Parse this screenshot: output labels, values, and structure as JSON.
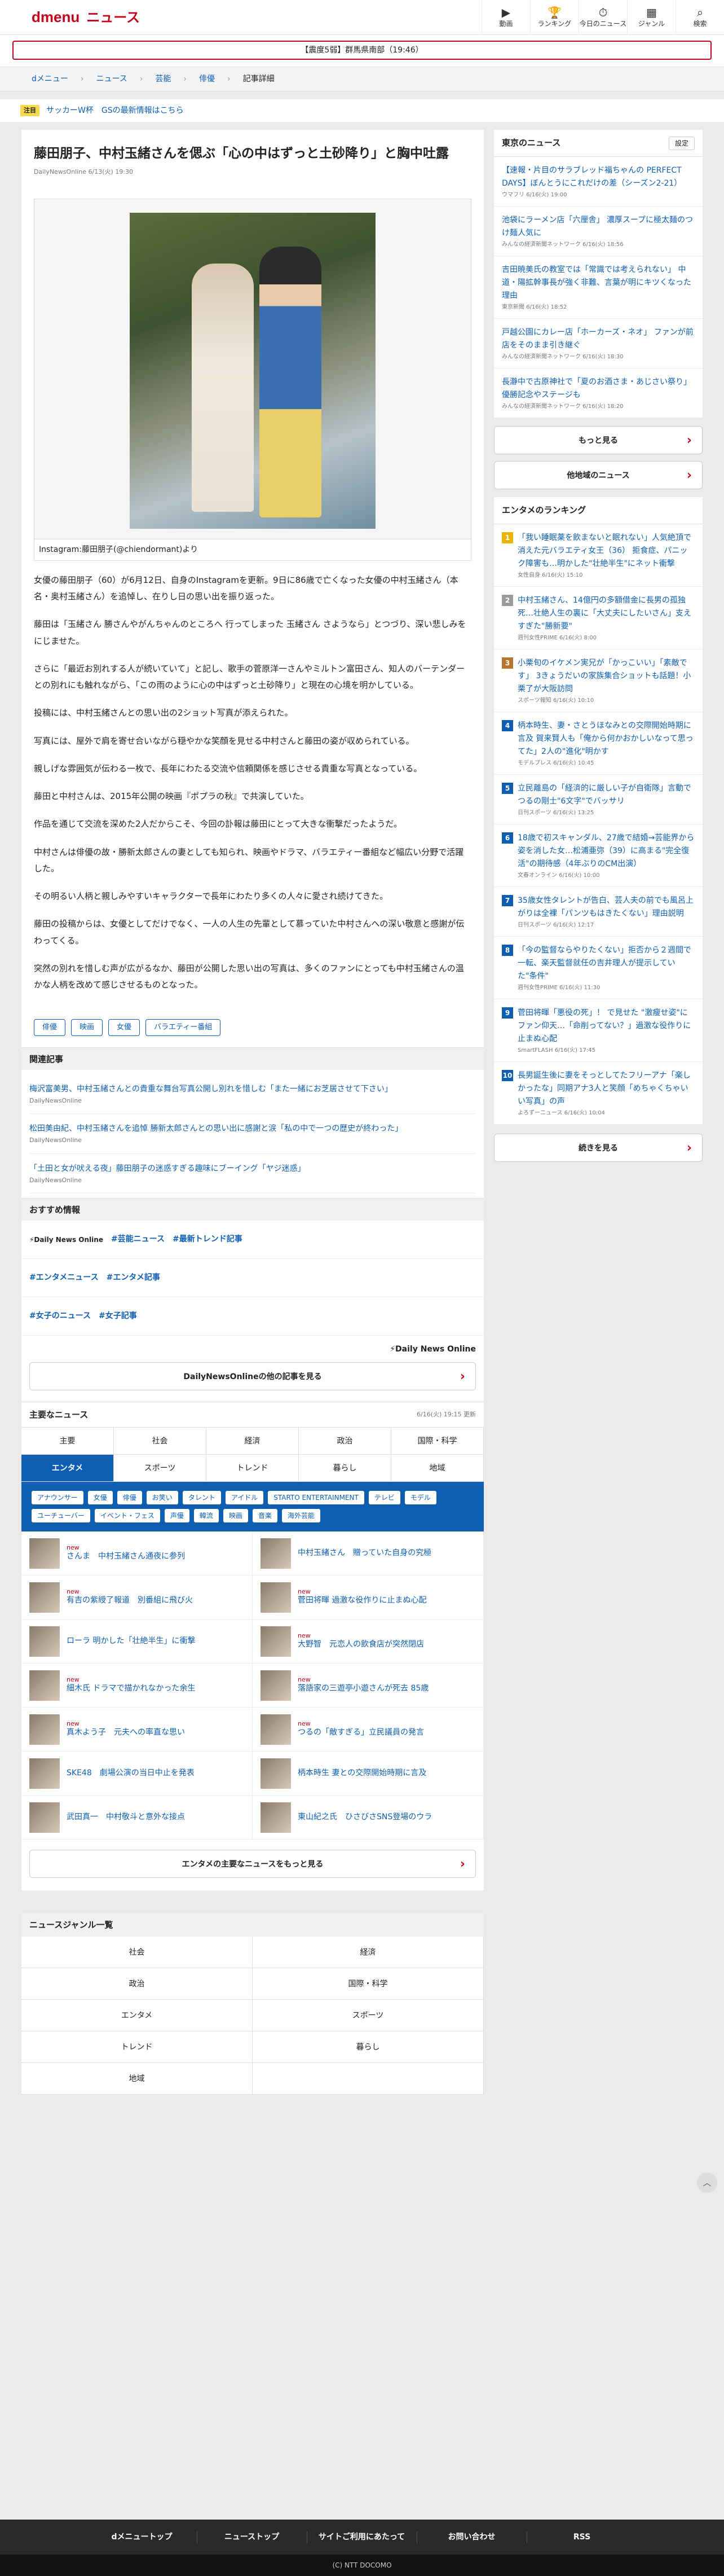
{
  "header": {
    "logo": "dmenu",
    "section": "ニュース",
    "nav": [
      {
        "icon": "video-icon",
        "glyph": "▶",
        "label": "動画"
      },
      {
        "icon": "trophy-icon",
        "glyph": "🏆",
        "label": "ランキング"
      },
      {
        "icon": "clock-icon",
        "glyph": "⏱",
        "label": "今日のニュース"
      },
      {
        "icon": "grid-icon",
        "glyph": "▦",
        "label": "ジャンル"
      },
      {
        "icon": "search-icon",
        "glyph": "⌕",
        "label": "検索"
      }
    ]
  },
  "alert": "【震度5弱】群馬県南部（19:46）",
  "breadcrumb": [
    "dメニュー",
    "ニュース",
    "芸能",
    "俳優",
    "記事詳細"
  ],
  "notice": {
    "tag": "注目",
    "text": "サッカーW杯　GSの最新情報はこちら"
  },
  "article": {
    "title": "藤田朋子、中村玉緒さんを偲ぶ「心の中はずっと土砂降り」と胸中吐露",
    "meta": "DailyNewsOnline 6/13(火) 19:30",
    "caption": "Instagram:藤田朋子(@chiendormant)より",
    "paragraphs": [
      "女優の藤田朋子（60）が6月12日、自身のInstagramを更新。9日に86歳で亡くなった女優の中村玉緒さん（本名・奥村玉緒さん）を追悼し、在りし日の思い出を振り返った。",
      "藤田は「玉緒さん 勝さんやがんちゃんのところへ 行ってしまった 玉緒さん さようなら」とつづり、深い悲しみをにじませた。",
      "さらに「最近お別れする人が続いていて」と記し、歌手の菅原洋一さんやミルトン富田さん、知人のバーテンダーとの別れにも触れながら、「この雨のように心の中はずっと土砂降り」と現在の心境を明かしている。",
      "投稿には、中村玉緒さんとの思い出の2ショット写真が添えられた。",
      "写真には、屋外で肩を寄せ合いながら穏やかな笑顔を見せる中村さんと藤田の姿が収められている。",
      "親しげな雰囲気が伝わる一枚で、長年にわたる交流や信頼関係を感じさせる貴重な写真となっている。",
      "藤田と中村さんは、2015年公開の映画『ポプラの秋』で共演していた。",
      "作品を通じて交流を深めた2人だからこそ、今回の訃報は藤田にとって大きな衝撃だったようだ。",
      "中村さんは俳優の故・勝新太郎さんの妻としても知られ、映画やドラマ、バラエティー番組など幅広い分野で活躍した。",
      "その明るい人柄と親しみやすいキャラクターで長年にわたり多くの人々に愛され続けてきた。",
      "藤田の投稿からは、女優としてだけでなく、一人の人生の先輩として慕っていた中村さんへの深い敬意と感謝が伝わってくる。",
      "突然の別れを惜しむ声が広がるなか、藤田が公開した思い出の写真は、多くのファンにとっても中村玉緒さんの温かな人柄を改めて感じさせるものとなった。"
    ],
    "tags": [
      "俳優",
      "映画",
      "女優",
      "バラエティー番組"
    ]
  },
  "related": {
    "title": "関連記事",
    "items": [
      {
        "text": "梅沢富美男、中村玉緒さんとの貴重な舞台写真公開し別れを惜しむ「また一緒にお芝居させて下さい」",
        "src": "DailyNewsOnline"
      },
      {
        "text": "松田美由紀、中村玉緒さんを追悼 勝新太郎さんとの思い出に感謝と涙「私の中で一つの歴史が終わった」",
        "src": "DailyNewsOnline"
      },
      {
        "text": "「土田と女が吠える夜」藤田朋子の迷惑すぎる趣味にブーイング「ヤジ迷惑」",
        "src": "DailyNewsOnline"
      }
    ]
  },
  "recommend": {
    "title": "おすすめ情報",
    "rows": [
      [
        "⚡Daily News Online",
        "#芸能ニュース",
        "#最新トレンド記事"
      ],
      [
        "#エンタメニュース",
        "#エンタメ記事"
      ],
      [
        "#女子のニュース",
        "#女子記事"
      ]
    ],
    "brand": "⚡Daily News Online",
    "more": "DailyNewsOnlineの他の記事を見る"
  },
  "mainnews": {
    "title": "主要なニュース",
    "updated": "6/16(火) 19:15 更新",
    "tabs": [
      "主要",
      "社会",
      "経済",
      "政治",
      "国際・科学",
      "エンタメ",
      "スポーツ",
      "トレンド",
      "暮らし",
      "地域"
    ],
    "subtags": [
      "アナウンサー",
      "女優",
      "俳優",
      "お笑い",
      "タレント",
      "アイドル",
      "STARTO ENTERTAINMENT",
      "テレビ",
      "モデル",
      "ユーチューバー",
      "イベント・フェス",
      "声優",
      "韓流",
      "映画",
      "音楽",
      "海外芸能"
    ],
    "items": [
      {
        "new": "new",
        "text": "さんま　中村玉緒さん通夜に参列"
      },
      {
        "new": "",
        "text": "中村玉緒さん　贈っていた自身の究極"
      },
      {
        "new": "new",
        "text": "有吉の紫綬了報道　別番組に飛び火"
      },
      {
        "new": "new",
        "text": "菅田将暉 過激な役作りに止まぬ心配"
      },
      {
        "new": "",
        "text": "ローラ 明かした「壮絶半生」に衝撃"
      },
      {
        "new": "new",
        "text": "大野智　元恋人の飲食店が突然閉店"
      },
      {
        "new": "new",
        "text": "細木氏 ドラマで描かれなかった余生"
      },
      {
        "new": "new",
        "text": "落語家の三遊亭小遊さんが死去 85歳"
      },
      {
        "new": "new",
        "text": "真木よう子　元夫への率直な思い"
      },
      {
        "new": "new",
        "text": "つるの「敵すぎる」立民議員の発言"
      },
      {
        "new": "",
        "text": "SKE48　劇場公演の当日中止を発表"
      },
      {
        "new": "",
        "text": "柄本時生 妻との交際開始時期に言及"
      },
      {
        "new": "",
        "text": "武田真一　中村敬斗と意外な接点"
      },
      {
        "new": "",
        "text": "東山紀之氏　ひさびさSNS登場のウラ"
      }
    ],
    "more": "エンタメの主要なニュースをもっと見る"
  },
  "genre": {
    "title": "ニュースジャンル一覧",
    "items": [
      "社会",
      "経済",
      "政治",
      "国際・科学",
      "エンタメ",
      "スポーツ",
      "トレンド",
      "暮らし",
      "地域",
      ""
    ]
  },
  "side": {
    "local": {
      "title": "東京のニュース",
      "set": "設定",
      "items": [
        {
          "text": "【速報・片目のサラブレッド福ちゃんの PERFECT DAYS】ぼんとうにこれだけの差（シーズン2-21）",
          "src": "ウマフリ 6/16(火) 19:00"
        },
        {
          "text": "池袋にラーメン店「六厘舎」 濃厚スープに極太麺のつけ麺人気に",
          "src": "みんなの経済新聞ネットワーク 6/16(火) 18:56"
        },
        {
          "text": "吉田暁美氏の教室では「常識では考えられない」 中道・陽拡幹事長が強く非難、言葉が明にキツくなった理由",
          "src": "東京新聞 6/16(火) 18:52"
        },
        {
          "text": "戸越公園にカレー店「ホーカーズ・ネオ」 ファンが前店をそのまま引き継ぐ",
          "src": "みんなの経済新聞ネットワーク 6/16(火) 18:30"
        },
        {
          "text": "長瀞中で古原神社で「夏のお酒さま・あじさい祭り」 優勝記念やステージも",
          "src": "みんなの経済新聞ネットワーク 6/16(火) 18:20"
        }
      ],
      "more": "もっと見る",
      "other": "他地域のニュース"
    },
    "rank": {
      "title": "エンタメのランキング",
      "items": [
        {
          "no": "1",
          "color": "#e9b500",
          "text": "「我い睡眠薬を飲まないと眠れない」人気絶頂で消えた元バラエティ女王（36） 拒食症、パニック障害も…明かした\"壮絶半生\"にネット衝撃",
          "src": "女性自身 6/16(火) 15:10"
        },
        {
          "no": "2",
          "color": "#9a9a9a",
          "text": "中村玉緒さん、14億円の多額借金に長男の孤独死…壮絶人生の裏に「大丈夫にしたいさん」支えすぎた\"勝新要\"",
          "src": "週刊女性PRIME 6/16(火) 8:00"
        },
        {
          "no": "3",
          "color": "#b7772e",
          "text": "小栗旬のイケメン実兄が「かっこいい」「素敵です」 3きょうだいの家族集合ショットも話題！小栗了が大阪訪問",
          "src": "スポーツ報知 6/16(火) 10:10"
        },
        {
          "no": "4",
          "color": "#0e5fb4",
          "text": "柄本時生、妻・さとうほなみとの交際開始時期に言及 賀来賢人も「俺から何かおかしいなって思ってた」2人の\"進化\"明かす",
          "src": "モデルプレス 6/16(火) 10:45"
        },
        {
          "no": "5",
          "color": "#0e5fb4",
          "text": "立民離島の「経済的に厳しい子が自衛隊」言動でつるの剛士\"6文字\"でバッサリ",
          "src": "日刊スポーツ 6/16(火) 13:25"
        },
        {
          "no": "6",
          "color": "#0e5fb4",
          "text": "18歳で初スキャンダル、27歳で結婚→芸能界から姿を消した女…松浦亜弥（39）に高まる\"完全復活\"の期待感（4年ぶりのCM出演）",
          "src": "文春オンライン 6/16(火) 10:00"
        },
        {
          "no": "7",
          "color": "#0e5fb4",
          "text": "35歳女性タレントが告白、芸人夫の前でも風呂上がりは全裸「パンツもはきたくない」理由説明",
          "src": "日刊スポーツ 6/16(火) 12:17"
        },
        {
          "no": "8",
          "color": "#0e5fb4",
          "text": "「今の監督ならやりたくない」拒否から２週間で一転、楽天監督就任の吉井理人が提示していた\"条件\"",
          "src": "週刊女性PRIME 6/16(火) 11:30"
        },
        {
          "no": "9",
          "color": "#0e5fb4",
          "text": "菅田将暉「悪役の死」！ で見せた \"激瘦せ姿\"にファン仰天…「命削ってない？」過激な役作りに止まぬ心配",
          "src": "SmartFLASH 6/16(火) 17:45"
        },
        {
          "no": "10",
          "color": "#0e5fb4",
          "text": "長男誕生後に妻をそっとしてたフリーアナ「楽しかったな」同期アナ3人と笑顔「めちゃくちゃいい写真」の声",
          "src": "よろずーニュース 6/16(火) 10:04"
        }
      ],
      "more": "続きを見る"
    }
  },
  "footer": {
    "links": [
      "dメニュートップ",
      "ニューストップ",
      "サイトご利用にあたって",
      "お問い合わせ",
      "RSS"
    ],
    "copyright": "(C) NTT DOCOMO"
  }
}
